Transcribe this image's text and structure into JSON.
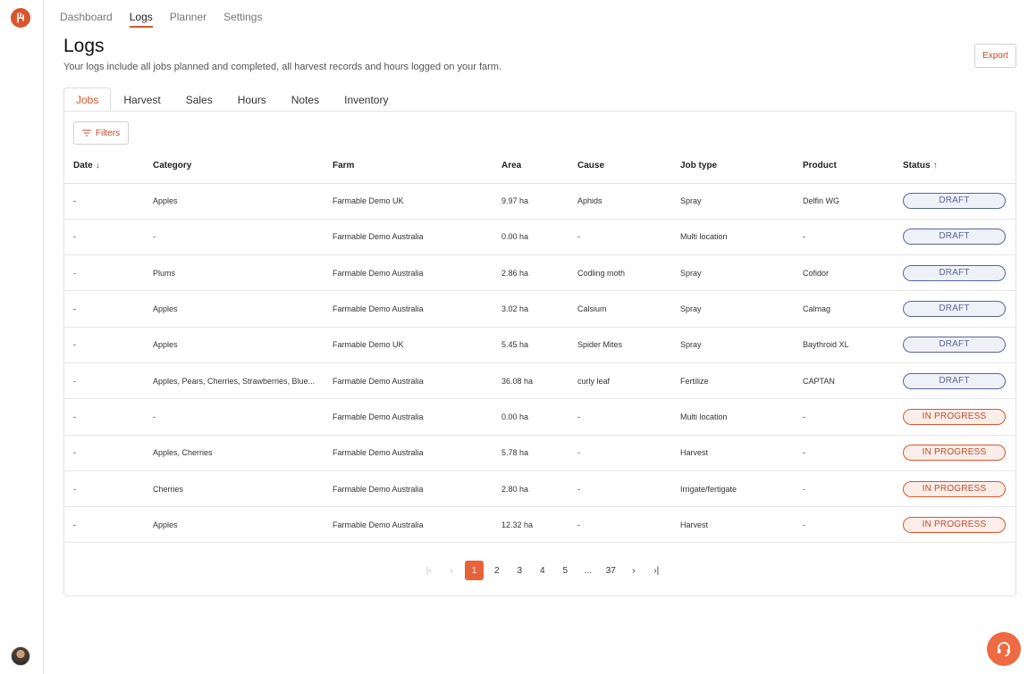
{
  "nav": {
    "items": [
      {
        "label": "Dashboard",
        "active": false
      },
      {
        "label": "Logs",
        "active": true
      },
      {
        "label": "Planner",
        "active": false
      },
      {
        "label": "Settings",
        "active": false
      }
    ]
  },
  "header": {
    "title": "Logs",
    "subtitle": "Your logs include all jobs planned and completed, all harvest records and hours logged on your farm.",
    "export_label": "Export"
  },
  "tabs": [
    {
      "label": "Jobs",
      "active": true
    },
    {
      "label": "Harvest",
      "active": false
    },
    {
      "label": "Sales",
      "active": false
    },
    {
      "label": "Hours",
      "active": false
    },
    {
      "label": "Notes",
      "active": false
    },
    {
      "label": "Inventory",
      "active": false
    }
  ],
  "filters_label": "Filters",
  "table": {
    "columns": [
      {
        "label": "Date",
        "sort": "↓"
      },
      {
        "label": "Category",
        "sort": ""
      },
      {
        "label": "Farm",
        "sort": ""
      },
      {
        "label": "Area",
        "sort": ""
      },
      {
        "label": "Cause",
        "sort": ""
      },
      {
        "label": "Job type",
        "sort": ""
      },
      {
        "label": "Product",
        "sort": ""
      },
      {
        "label": "Status",
        "sort": "↑"
      }
    ],
    "rows": [
      {
        "date": "-",
        "category": "Apples",
        "farm": "Farmable Demo UK",
        "area": "9.97 ha",
        "cause": "Aphids",
        "job_type": "Spray",
        "product": "Delfin WG",
        "status": "DRAFT",
        "status_kind": "draft"
      },
      {
        "date": "-",
        "category": "-",
        "farm": "Farmable Demo Australia",
        "area": "0.00 ha",
        "cause": "-",
        "job_type": "Multi location",
        "product": "-",
        "status": "DRAFT",
        "status_kind": "draft"
      },
      {
        "date": "-",
        "category": "Plums",
        "farm": "Farmable Demo Australia",
        "area": "2.86 ha",
        "cause": "Codling moth",
        "job_type": "Spray",
        "product": "Cofidor",
        "status": "DRAFT",
        "status_kind": "draft"
      },
      {
        "date": "-",
        "category": "Apples",
        "farm": "Farmable Demo Australia",
        "area": "3.02 ha",
        "cause": "Calsium",
        "job_type": "Spray",
        "product": "Calmag",
        "status": "DRAFT",
        "status_kind": "draft"
      },
      {
        "date": "-",
        "category": "Apples",
        "farm": "Farmable Demo UK",
        "area": "5.45 ha",
        "cause": "Spider Mites",
        "job_type": "Spray",
        "product": "Baythroid XL",
        "status": "DRAFT",
        "status_kind": "draft"
      },
      {
        "date": "-",
        "category": "Apples, Pears, Cherries, Strawberries, Blue...",
        "farm": "Farmable Demo Australia",
        "area": "36.08 ha",
        "cause": "curly leaf",
        "job_type": "Fertilize",
        "product": "CAPTAN",
        "status": "DRAFT",
        "status_kind": "draft"
      },
      {
        "date": "-",
        "category": "-",
        "farm": "Farmable Demo Australia",
        "area": "0.00 ha",
        "cause": "-",
        "job_type": "Multi location",
        "product": "-",
        "status": "IN PROGRESS",
        "status_kind": "progress"
      },
      {
        "date": "-",
        "category": "Apples, Cherries",
        "farm": "Farmable Demo Australia",
        "area": "5.78 ha",
        "cause": "-",
        "job_type": "Harvest",
        "product": "-",
        "status": "IN PROGRESS",
        "status_kind": "progress"
      },
      {
        "date": "-",
        "category": "Cherries",
        "farm": "Farmable Demo Australia",
        "area": "2.80 ha",
        "cause": "-",
        "job_type": "Irrigate/fertigate",
        "product": "-",
        "status": "IN PROGRESS",
        "status_kind": "progress"
      },
      {
        "date": "-",
        "category": "Apples",
        "farm": "Farmable Demo Australia",
        "area": "12.32 ha",
        "cause": "-",
        "job_type": "Harvest",
        "product": "-",
        "status": "IN PROGRESS",
        "status_kind": "progress"
      }
    ]
  },
  "pagination": {
    "items": [
      {
        "label": "|‹",
        "kind": "dim",
        "name": "first-page-icon"
      },
      {
        "label": "‹",
        "kind": "dim",
        "name": "prev-page-icon"
      },
      {
        "label": "1",
        "kind": "current",
        "name": "page-1"
      },
      {
        "label": "2",
        "kind": "",
        "name": "page-2"
      },
      {
        "label": "3",
        "kind": "",
        "name": "page-3"
      },
      {
        "label": "4",
        "kind": "",
        "name": "page-4"
      },
      {
        "label": "5",
        "kind": "",
        "name": "page-5"
      },
      {
        "label": "...",
        "kind": "",
        "name": "page-ellipsis"
      },
      {
        "label": "37",
        "kind": "",
        "name": "page-37"
      },
      {
        "label": "›",
        "kind": "",
        "name": "next-page-icon"
      },
      {
        "label": "›|",
        "kind": "",
        "name": "last-page-icon"
      }
    ]
  },
  "icons": {
    "logo": "farmable-logo",
    "filter": "filter-icon",
    "help": "headset-icon",
    "avatar": "user-avatar"
  },
  "colors": {
    "accent": "#d9552d",
    "draft": "#5a6690",
    "help_button": "#ed6a43"
  }
}
